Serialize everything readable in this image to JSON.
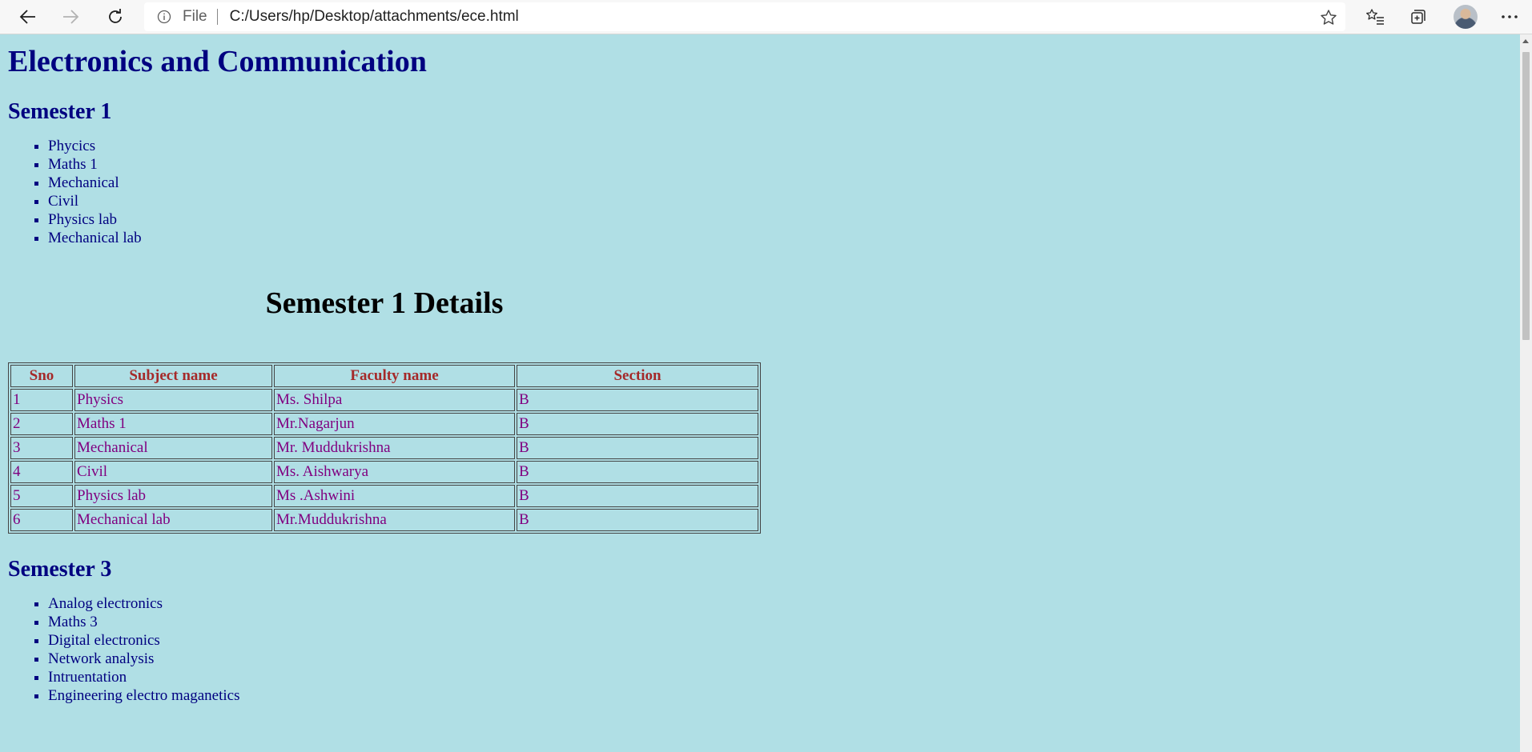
{
  "browser": {
    "file_label": "File",
    "url": "C:/Users/hp/Desktop/attachments/ece.html"
  },
  "page": {
    "title": "Electronics and Communication",
    "semester1": {
      "heading": "Semester 1",
      "subjects": [
        "Phycics",
        "Maths 1",
        "Mechanical",
        "Civil",
        "Physics lab",
        "Mechanical lab"
      ]
    },
    "details": {
      "heading": "Semester 1 Details",
      "columns": [
        "Sno",
        "Subject name",
        "Faculty name",
        "Section"
      ],
      "rows": [
        [
          "1",
          "Physics",
          "Ms. Shilpa",
          "B"
        ],
        [
          "2",
          "Maths 1",
          "Mr.Nagarjun",
          "B"
        ],
        [
          "3",
          "Mechanical",
          "Mr. Muddukrishna",
          "B"
        ],
        [
          "4",
          "Civil",
          "Ms. Aishwarya",
          "B"
        ],
        [
          "5",
          "Physics lab",
          "Ms .Ashwini",
          "B"
        ],
        [
          "6",
          "Mechanical lab",
          "Mr.Muddukrishna",
          "B"
        ]
      ]
    },
    "semester3": {
      "heading": "Semester 3",
      "subjects": [
        "Analog electronics",
        "Maths 3",
        "Digital electronics",
        "Network analysis",
        "Intruentation",
        "Engineering electro maganetics"
      ]
    }
  },
  "colors": {
    "page_background": "#b0dfe5",
    "heading_color": "#000080",
    "table_header_color": "#a52a2a",
    "table_cell_color": "#800080"
  }
}
